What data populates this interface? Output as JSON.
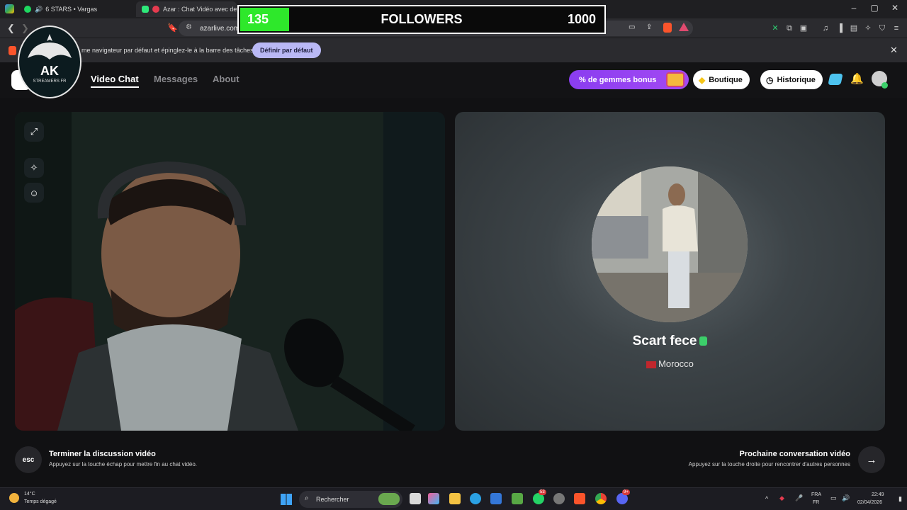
{
  "browser": {
    "tabs": [
      {
        "label": "6 STARS • Vargas"
      },
      {
        "label": "Azar : Chat Vidéo avec de no"
      }
    ],
    "url": "azarlive.com",
    "window_controls": [
      "–",
      "▢",
      "✕"
    ]
  },
  "notification": {
    "text": "me navigateur par défaut et épinglez-le à la barre des tâches",
    "button": "Définir par défaut"
  },
  "followers_goal": {
    "current": "135",
    "label": "FOLLOWERS",
    "goal": "1000",
    "progress": 0.135
  },
  "logo": {
    "title": "AK",
    "subtitle": "STREAMERS FR"
  },
  "app": {
    "nav": [
      "Video Chat",
      "Messages",
      "About"
    ],
    "promo": "% de gemmes bonus",
    "shop": "Boutique",
    "history": "Historique"
  },
  "partner": {
    "name": "Scart fece",
    "country": "Morocco"
  },
  "hints": {
    "esc_key": "esc",
    "end_title": "Terminer la discussion vidéo",
    "end_sub": "Appuyez sur la touche échap pour mettre fin au chat vidéo.",
    "next_title": "Prochaine conversation vidéo",
    "next_sub": "Appuyez sur la touche droite pour rencontrer d'autres personnes"
  },
  "taskbar": {
    "weather_temp": "14°C",
    "weather_desc": "Temps dégagé",
    "search": "Rechercher",
    "lang_top": "FRA",
    "lang_bottom": "FR",
    "time": "22:49",
    "date": "02/04/2026",
    "badge_whatsapp": "53",
    "badge_discord": "9+"
  },
  "colors": {
    "progress_green": "#2ee82b",
    "promo_purple": "#9a44f2",
    "notif_button": "#b9b8f5"
  }
}
